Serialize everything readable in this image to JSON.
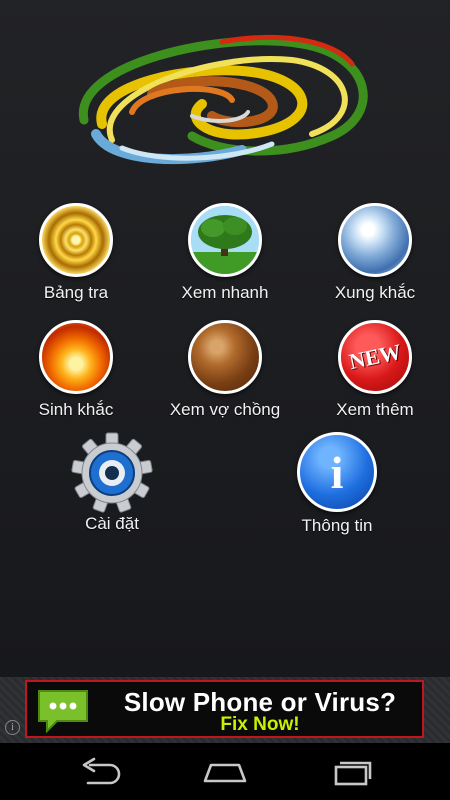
{
  "menu": {
    "items": [
      {
        "label": "Bảng tra",
        "icon": "gold-swirl-icon"
      },
      {
        "label": "Xem nhanh",
        "icon": "tree-icon"
      },
      {
        "label": "Xung khắc",
        "icon": "water-orb-icon"
      },
      {
        "label": "Sinh khắc",
        "icon": "fire-icon"
      },
      {
        "label": "Xem vợ chồng",
        "icon": "earth-orb-icon"
      },
      {
        "label": "Xem thêm",
        "icon": "new-badge-icon"
      },
      {
        "label": "Cài đặt",
        "icon": "gear-icon"
      },
      {
        "label": "Thông tin",
        "icon": "info-icon"
      }
    ],
    "new_badge_text": "NEW",
    "info_glyph": "i"
  },
  "ad": {
    "title": "Slow Phone or Virus?",
    "subtitle": "Fix Now!",
    "info_glyph": "i",
    "accent": "#c2161e",
    "subtitle_color": "#c8f000"
  },
  "navbar": {
    "buttons": [
      "back-icon",
      "home-icon",
      "recent-apps-icon"
    ]
  }
}
